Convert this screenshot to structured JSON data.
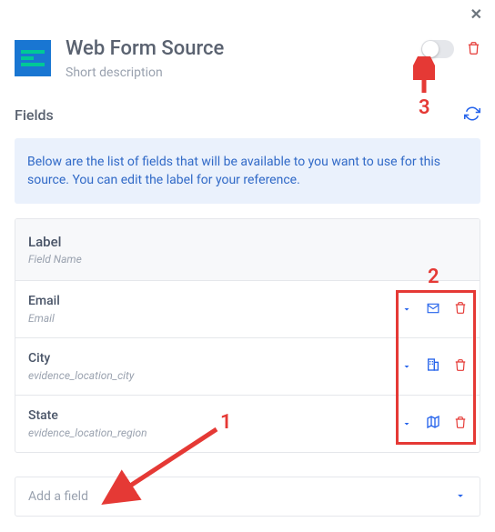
{
  "header": {
    "title": "Web Form Source",
    "subtitle": "Short description"
  },
  "section": {
    "title": "Fields"
  },
  "banner": {
    "text": "Below are the list of fields that will be available to you want to use for this source. You can edit the label for your reference."
  },
  "table": {
    "head": {
      "label": "Label",
      "sub": "Field Name"
    },
    "rows": [
      {
        "label": "Email",
        "field": "Email",
        "icon": "envelope"
      },
      {
        "label": "City",
        "field": "evidence_location_city",
        "icon": "building"
      },
      {
        "label": "State",
        "field": "evidence_location_region",
        "icon": "map"
      }
    ]
  },
  "addField": {
    "placeholder": "Add a field"
  },
  "annotations": {
    "n1": "1",
    "n2": "2",
    "n3": "3"
  }
}
